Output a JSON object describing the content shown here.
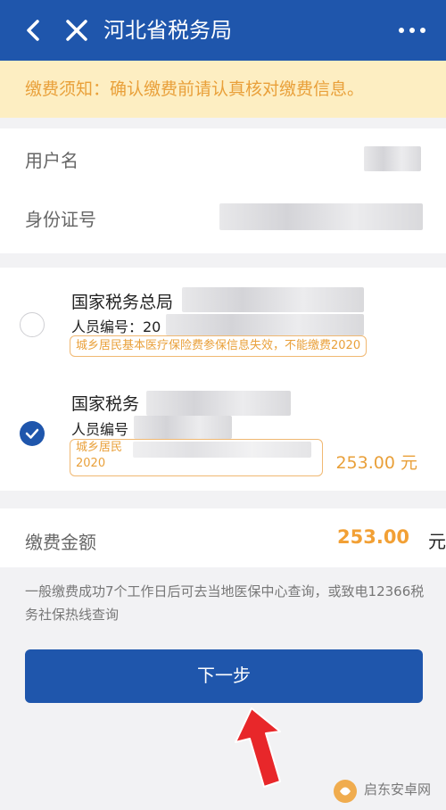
{
  "header": {
    "title": "河北省税务局",
    "back_icon": "chevron-left-icon",
    "close_icon": "close-icon",
    "more_icon": "more-dots-icon"
  },
  "notice": {
    "text": "缴费须知：确认缴费前请认真核对缴费信息。"
  },
  "info": {
    "username_label": "用户名",
    "id_label": "身份证号"
  },
  "items": [
    {
      "name": "国家税务总局",
      "id_label": "人员编号：20",
      "tag": "城乡居民基本医疗保险费参保信息失效，不能缴费2020",
      "selected": false
    },
    {
      "name": "国家税务",
      "id_label": "人员编号",
      "tag_line1": "城乡居民",
      "tag_line2": "2020",
      "amount": "253.00 元",
      "selected": true
    }
  ],
  "total": {
    "label": "缴费金额",
    "value": "253.00",
    "unit": "元"
  },
  "hint": "一般缴费成功7个工作日后可去当地医保中心查询，或致电12366税务社保热线查询",
  "next_button": "下一步",
  "watermark": "启东安卓网"
}
